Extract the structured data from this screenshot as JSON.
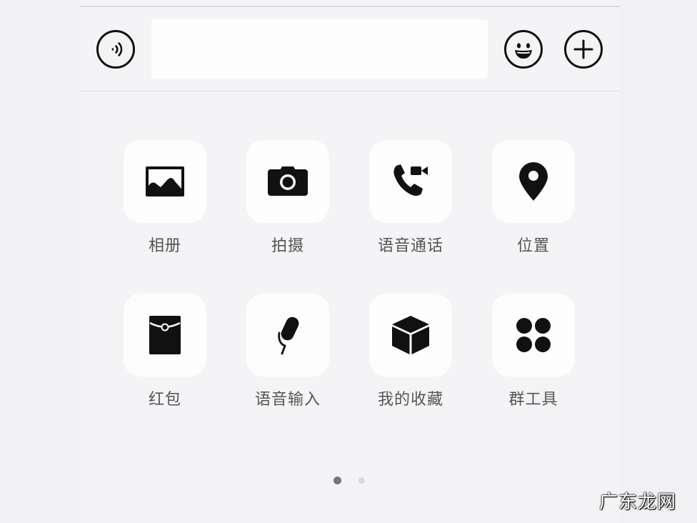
{
  "input_bar": {
    "voice_icon": "voice-icon",
    "text_value": "",
    "text_placeholder": "",
    "emoji_icon": "smiley-icon",
    "plus_icon": "plus-icon"
  },
  "panel_items": [
    {
      "label": "相册",
      "icon": "photo-icon"
    },
    {
      "label": "拍摄",
      "icon": "camera-icon"
    },
    {
      "label": "语音通话",
      "icon": "phone-video-call-icon"
    },
    {
      "label": "位置",
      "icon": "location-pin-icon"
    },
    {
      "label": "红包",
      "icon": "red-envelope-icon"
    },
    {
      "label": "语音输入",
      "icon": "microphone-icon"
    },
    {
      "label": "我的收藏",
      "icon": "favorites-cube-icon"
    },
    {
      "label": "群工具",
      "icon": "group-tools-icon"
    }
  ],
  "pagination": {
    "total": 2,
    "current": 1
  },
  "watermark": "广东龙网"
}
